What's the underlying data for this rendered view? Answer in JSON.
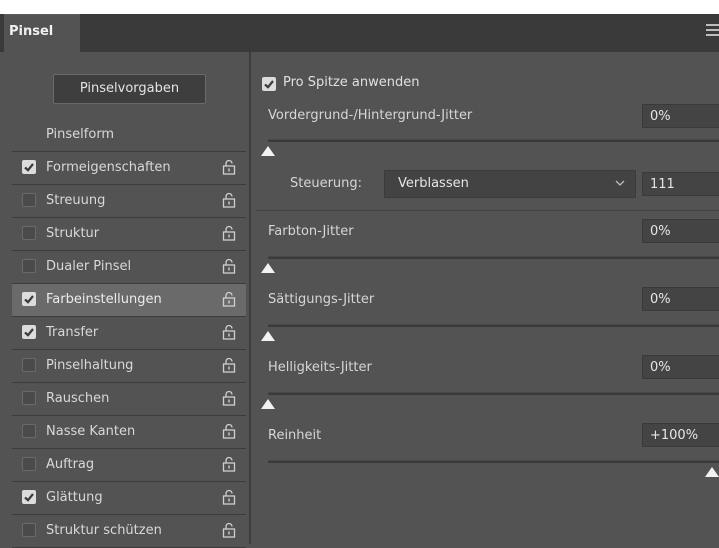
{
  "panel": {
    "tab_label": "Pinsel"
  },
  "left": {
    "preset_button": "Pinselvorgaben",
    "form_label": "Pinselform",
    "items": [
      {
        "label": "Formeigenschaften",
        "checked": true,
        "selected": false
      },
      {
        "label": "Streuung",
        "checked": false,
        "selected": false
      },
      {
        "label": "Struktur",
        "checked": false,
        "selected": false
      },
      {
        "label": "Dualer Pinsel",
        "checked": false,
        "selected": false
      },
      {
        "label": "Farbeinstellungen",
        "checked": true,
        "selected": true
      },
      {
        "label": "Transfer",
        "checked": true,
        "selected": false
      },
      {
        "label": "Pinselhaltung",
        "checked": false,
        "selected": false
      },
      {
        "label": "Rauschen",
        "checked": false,
        "selected": false
      },
      {
        "label": "Nasse Kanten",
        "checked": false,
        "selected": false
      },
      {
        "label": "Auftrag",
        "checked": false,
        "selected": false
      },
      {
        "label": "Glättung",
        "checked": true,
        "selected": false
      },
      {
        "label": "Struktur schützen",
        "checked": false,
        "selected": false
      }
    ]
  },
  "right": {
    "per_tip": {
      "label": "Pro Spitze anwenden",
      "checked": true
    },
    "fg_bg_jitter": {
      "label": "Vordergrund-/Hintergrund-Jitter",
      "value": "0%",
      "slider_fraction": 0
    },
    "control": {
      "label": "Steuerung:",
      "selected": "Verblassen",
      "value": "111"
    },
    "hue_jitter": {
      "label": "Farbton-Jitter",
      "value": "0%",
      "slider_fraction": 0
    },
    "saturation_jitter": {
      "label": "Sättigungs-Jitter",
      "value": "0%",
      "slider_fraction": 0
    },
    "brightness_jitter": {
      "label": "Helligkeits-Jitter",
      "value": "0%",
      "slider_fraction": 0
    },
    "purity": {
      "label": "Reinheit",
      "value": "+100%",
      "slider_fraction": 1
    }
  },
  "colors": {
    "panel_bg": "#535353",
    "tab_bar": "#3a3a3a",
    "selected_row": "#6a6a6a"
  }
}
